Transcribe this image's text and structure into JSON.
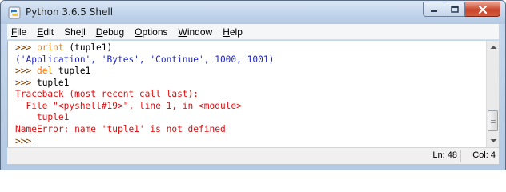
{
  "window": {
    "title": "Python 3.6.5 Shell",
    "controls": {
      "minimize": "minimize",
      "maximize": "maximize",
      "close": "close"
    }
  },
  "menubar": [
    {
      "key": "F",
      "rest": "ile"
    },
    {
      "key": "E",
      "rest": "dit"
    },
    {
      "pre": "She",
      "key": "l",
      "rest": "l"
    },
    {
      "key": "D",
      "rest": "ebug"
    },
    {
      "key": "O",
      "rest": "ptions"
    },
    {
      "key": "W",
      "rest": "indow"
    },
    {
      "key": "H",
      "rest": "elp"
    }
  ],
  "shell": {
    "prompt": ">>> ",
    "lines": [
      {
        "prompt": ">>> ",
        "keyword": "print",
        "code": " (tuple1)"
      },
      {
        "output": "('Application', 'Bytes', 'Continue', 1000, 1001)"
      },
      {
        "prompt": ">>> ",
        "keyword": "del",
        "code": " tuple1"
      },
      {
        "prompt": ">>> ",
        "code": "tuple1"
      },
      {
        "error": "Traceback (most recent call last):"
      },
      {
        "error": "  File \"<pyshell#19>\", line 1, in <module>"
      },
      {
        "error": "    tuple1"
      },
      {
        "error": "NameError: name 'tuple1' is not defined"
      },
      {
        "prompt": ">>> ",
        "cursor": true
      }
    ]
  },
  "statusbar": {
    "line": "Ln: 48",
    "column": "Col: 4"
  },
  "colors": {
    "prompt": "#7a3d00",
    "keyword": "#ff7700",
    "output": "#1f26bb",
    "error": "#dd1010"
  },
  "icons": {
    "app": "python-idle-icon",
    "minimize": "minimize-icon",
    "maximize": "maximize-icon",
    "close": "close-icon",
    "scroll_up": "chevron-up-icon",
    "scroll_down": "chevron-down-icon"
  }
}
